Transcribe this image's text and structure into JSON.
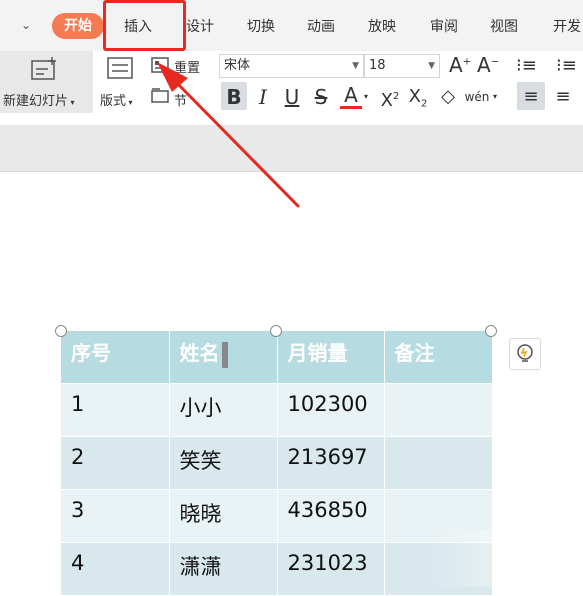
{
  "tabs": {
    "home": "开始",
    "items": [
      "插入",
      "设计",
      "切换",
      "动画",
      "放映",
      "审阅",
      "视图",
      "开发"
    ]
  },
  "ribbon": {
    "new_slide": "新建幻灯片",
    "layout": "版式",
    "reset": "重置",
    "section": "节",
    "font_name": "宋体",
    "font_size": "18"
  },
  "table": {
    "headers": [
      "序号",
      "姓名",
      "月销量",
      "备注"
    ],
    "rows": [
      [
        "1",
        "小小",
        "102300",
        ""
      ],
      [
        "2",
        "笑笑",
        "213697",
        ""
      ],
      [
        "3",
        "晓晓",
        "436850",
        ""
      ],
      [
        "4",
        "潇潇",
        "231023",
        ""
      ]
    ]
  },
  "colors": {
    "accent_tab": "#f47b52",
    "highlight": "#e8291f",
    "header_bg": "#b6dbe0"
  }
}
